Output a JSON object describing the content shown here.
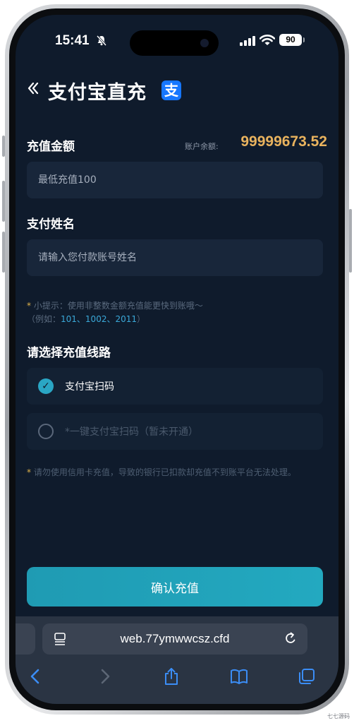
{
  "status": {
    "time": "15:41",
    "battery": "90"
  },
  "header": {
    "back_icon": "double-chevron-left",
    "title": "支付宝直充",
    "logo_glyph": "支"
  },
  "amount": {
    "label": "充值金额",
    "balance_label": "账户余额:",
    "balance_value": "99999673.52",
    "placeholder": "最低充值100"
  },
  "name": {
    "label": "支付姓名",
    "placeholder": "请输入您付款账号姓名"
  },
  "tip": {
    "star": "*",
    "line1": "小提示：使用非整数金额充值能更快到账哦～",
    "prefix": "（例如：",
    "examples": "101、1002、2011",
    "suffix": "）"
  },
  "routes": {
    "label": "请选择充值线路",
    "items": [
      {
        "label": "支付宝扫码",
        "selected": true
      },
      {
        "label": "*一键支付宝扫码（暂未开通）",
        "selected": false
      }
    ]
  },
  "warning": {
    "star": "*",
    "text": "请勿使用信用卡充值，导致的银行已扣款却充值不到账平台无法处理。"
  },
  "confirm_label": "确认充值",
  "browser": {
    "url": "web.77ymwwcsz.cfd"
  },
  "watermark": "七七源码",
  "colors": {
    "background": "#0f1b2c",
    "field": "#18263a",
    "accent": "#23a9c0",
    "balance": "#e9b35e"
  }
}
